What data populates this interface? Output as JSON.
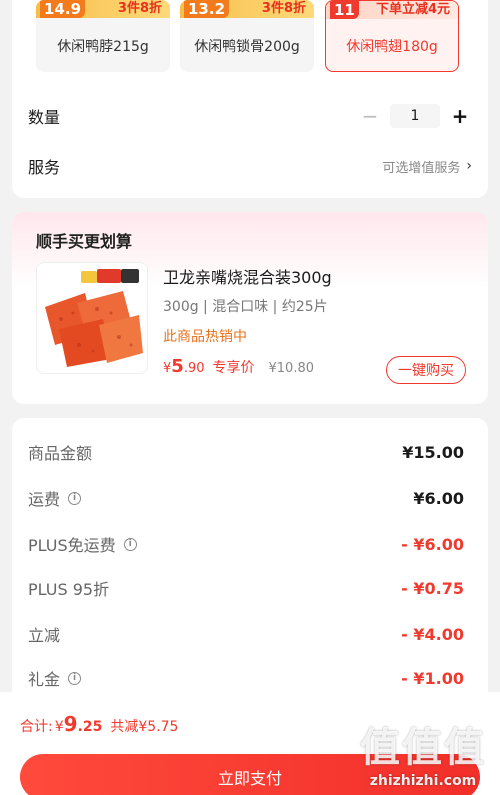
{
  "variants": [
    {
      "price": "14.9",
      "promo": "3件8折",
      "name": "休闲鸭脖215g",
      "selected": false
    },
    {
      "price": "13.2",
      "promo": "3件8折",
      "name": "休闲鸭锁骨200g",
      "selected": false
    },
    {
      "price": "11",
      "promo": "下单立减4元",
      "name": "休闲鸭翅180g",
      "selected": true
    }
  ],
  "quantity": {
    "label": "数量",
    "minus": "−",
    "value": "1",
    "plus": "+"
  },
  "service": {
    "label": "服务",
    "value": "可选增值服务",
    "chevron": "›"
  },
  "bundle": {
    "title": "顺手买更划算",
    "product_name": "卫龙亲嘴烧混合装300g",
    "spec": "300g | 混合口味 | 约25片",
    "hot": "此商品热销中",
    "price_symbol": "¥",
    "price_int": "5",
    "price_dec": ".90",
    "price_tag": "专享价",
    "original_price": "¥10.80",
    "buy_label": "一键购买"
  },
  "summary": {
    "rows": [
      {
        "label": "商品金额",
        "value": "¥15.00",
        "info": false,
        "red": false
      },
      {
        "label": "运费",
        "value": "¥6.00",
        "info": true,
        "red": false
      },
      {
        "label": "PLUS免运费",
        "value": "- ¥6.00",
        "info": true,
        "red": true
      },
      {
        "label": "PLUS 95折",
        "value": "- ¥0.75",
        "info": false,
        "red": true
      },
      {
        "label": "立减",
        "value": "- ¥4.00",
        "info": false,
        "red": true
      },
      {
        "label": "礼金",
        "value": "- ¥1.00",
        "info": true,
        "red": true
      }
    ]
  },
  "footer": {
    "total_label": "合计:",
    "total_symbol": "¥",
    "total_int": "9",
    "total_dec": ".25",
    "saved": "共减¥5.75",
    "pay_label": "立即支付"
  },
  "watermark": {
    "glyphs": "值值值",
    "url": "zhizhizhi.com"
  },
  "colors": {
    "accent": "#f03a2e",
    "hot": "#e8731e"
  }
}
